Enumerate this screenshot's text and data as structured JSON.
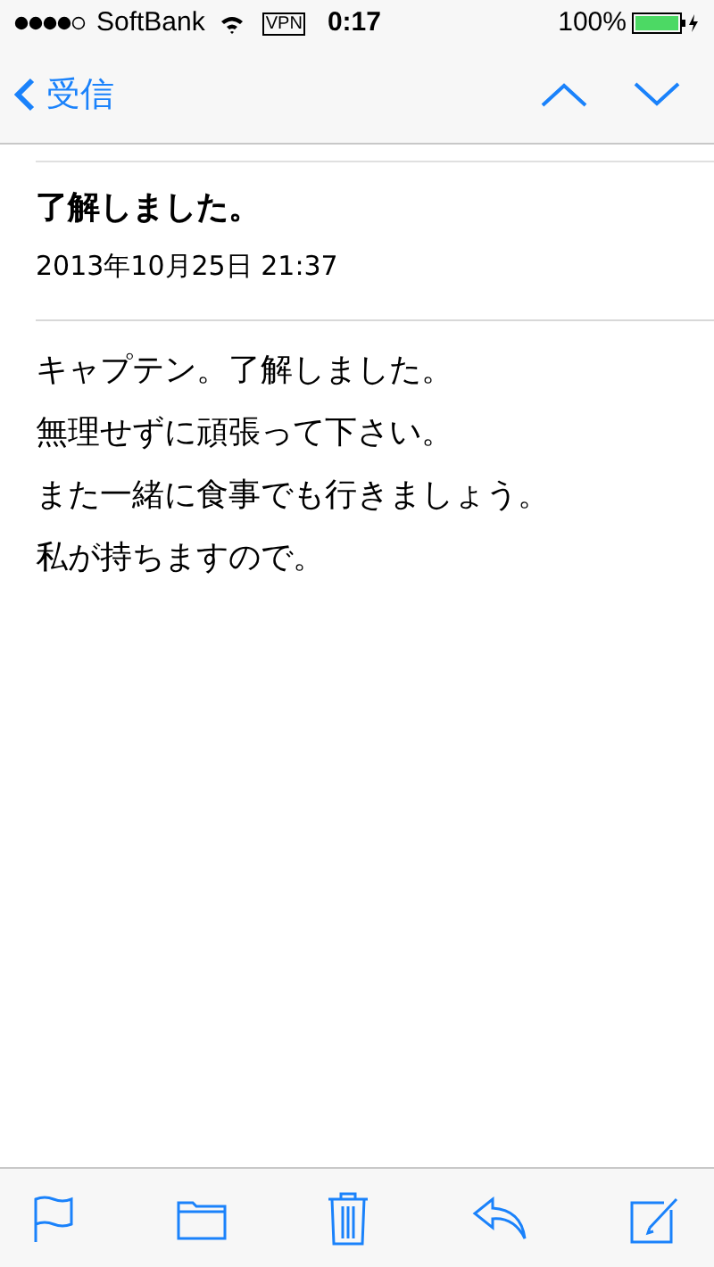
{
  "status_bar": {
    "carrier": "SoftBank",
    "vpn": "VPN",
    "time": "0:17",
    "battery": "100%"
  },
  "nav": {
    "back_label": "受信"
  },
  "message": {
    "subject": "了解しました。",
    "date": "2013年10月25日 21:37",
    "body": [
      "キャプテン。了解しました。",
      "無理せずに頑張って下さい。",
      "また一緒に食事でも行きましょう。",
      "私が持ちますので。"
    ]
  }
}
